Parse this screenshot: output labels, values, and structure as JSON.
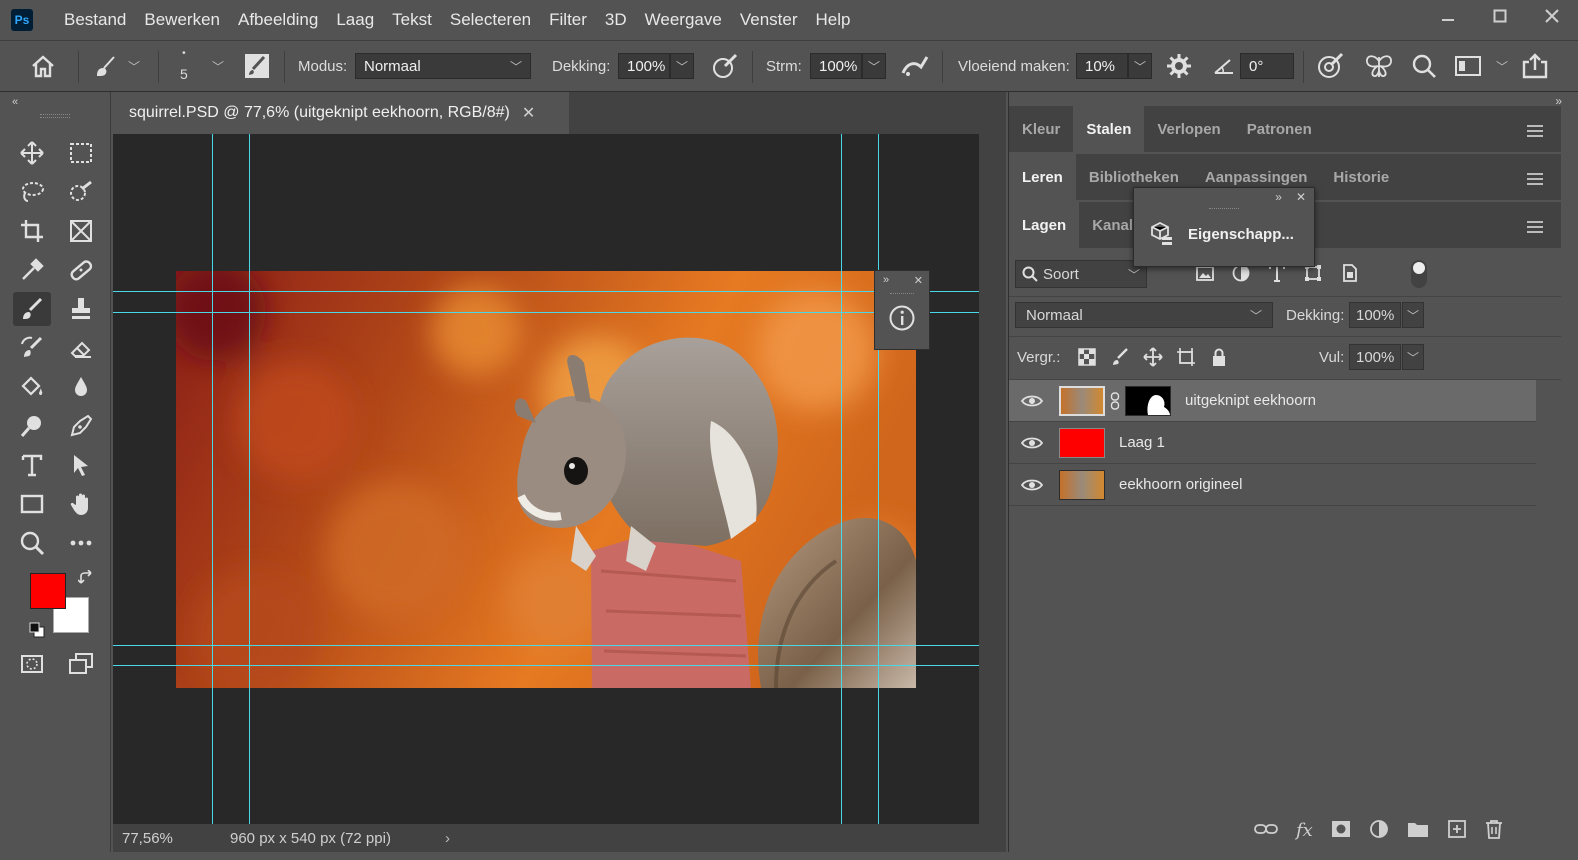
{
  "app": {
    "logo_text": "Ps",
    "accent": "#31a8ff"
  },
  "menu": [
    "Bestand",
    "Bewerken",
    "Afbeelding",
    "Laag",
    "Tekst",
    "Selecteren",
    "Filter",
    "3D",
    "Weergave",
    "Venster",
    "Help"
  ],
  "window_controls": [
    "minimize",
    "maximize",
    "close"
  ],
  "options": {
    "brush_size": "5",
    "modus_label": "Modus:",
    "modus_value": "Normaal",
    "dekking_label": "Dekking:",
    "dekking_value": "100%",
    "strm_label": "Strm:",
    "strm_value": "100%",
    "vloeiend_label": "Vloeiend maken:",
    "vloeiend_value": "10%",
    "angle_value": "0°"
  },
  "document": {
    "tab_title": "squirrel.PSD @ 77,6% (uitgeknipt eekhoorn, RGB/8#)",
    "zoom": "77,56%",
    "dimensions": "960 px x 540 px (72 ppi)"
  },
  "colors": {
    "foreground": "#ff0000",
    "background": "#ffffff",
    "guide": "#4ad8e8"
  },
  "panels": {
    "row1": [
      "Kleur",
      "Stalen",
      "Verlopen",
      "Patronen"
    ],
    "row1_active": "Stalen",
    "row2": [
      "Leren",
      "Bibliotheken",
      "Aanpassingen",
      "Historie"
    ],
    "row2_active": "Leren",
    "row3": [
      "Lagen",
      "Kanalen"
    ],
    "row3_active": "Lagen"
  },
  "eigenschappen_popup": {
    "label": "Eigenschapp..."
  },
  "layers": {
    "filter_label": "Soort",
    "blend_mode": "Normaal",
    "dekking_label": "Dekking:",
    "dekking_value": "100%",
    "lock_label": "Vergr.:",
    "fill_label": "Vul:",
    "fill_value": "100%",
    "items": [
      {
        "name": "uitgeknipt eekhoorn",
        "selected": true,
        "has_mask": true
      },
      {
        "name": "Laag 1",
        "selected": false,
        "fill_color": "#ff0000"
      },
      {
        "name": "eekhoorn origineel",
        "selected": false
      }
    ]
  }
}
